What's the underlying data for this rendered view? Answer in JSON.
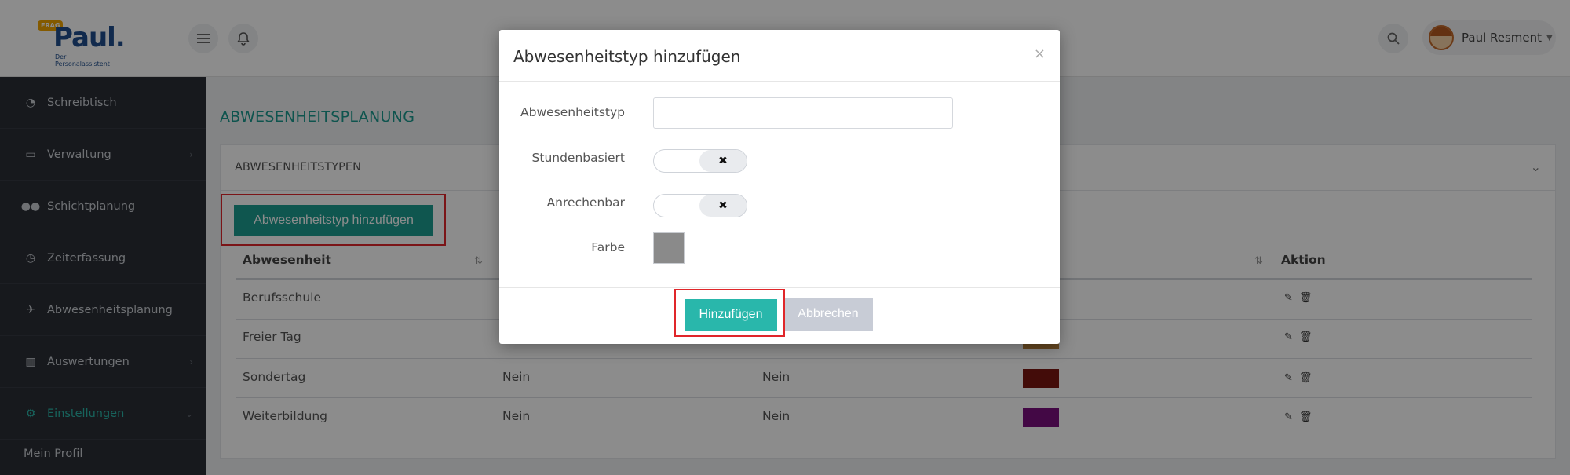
{
  "brand": {
    "bubble": "FRAG",
    "name": "Paul.",
    "tagline": "Der Personalassistent"
  },
  "header": {
    "user_name": "Paul Resment"
  },
  "sidebar": {
    "items": [
      {
        "label": "Schreibtisch",
        "icon": "dashboard-icon"
      },
      {
        "label": "Verwaltung",
        "icon": "laptop-icon"
      },
      {
        "label": "Schichtplanung",
        "icon": "users-icon"
      },
      {
        "label": "Zeiterfassung",
        "icon": "clock-icon"
      },
      {
        "label": "Abwesenheitsplanung",
        "icon": "plane-icon"
      },
      {
        "label": "Auswertungen",
        "icon": "bar-chart-icon"
      },
      {
        "label": "Einstellungen",
        "icon": "cogs-icon"
      }
    ],
    "sub_item": "Mein Profil"
  },
  "main": {
    "page_title": "ABWESENHEITSPLANUNG",
    "panel_title": "ABWESENHEITSTYPEN",
    "add_button": "Abwesenheitstyp hinzufügen",
    "table": {
      "headers": [
        "Abwesenheit",
        "Aktion"
      ],
      "rows": [
        {
          "name": "Berufsschule",
          "c2": "",
          "c3": "",
          "color": ""
        },
        {
          "name": "Freier Tag",
          "c2": "",
          "c3": "",
          "color": "#b8823c"
        },
        {
          "name": "Sondertag",
          "c2": "Nein",
          "c3": "Nein",
          "color": "#7a1612"
        },
        {
          "name": "Weiterbildung",
          "c2": "Nein",
          "c3": "Nein",
          "color": "#7a0f7f"
        }
      ]
    }
  },
  "modal": {
    "title": "Abwesenheitstyp hinzufügen",
    "close": "×",
    "fields": {
      "type_label": "Abwesenheitstyp",
      "type_value": "",
      "hours_label": "Stundenbasiert",
      "credit_label": "Anrechenbar",
      "color_label": "Farbe"
    },
    "toggle_off_symbol": "✖",
    "submit": "Hinzufügen",
    "cancel": "Abbrechen"
  }
}
